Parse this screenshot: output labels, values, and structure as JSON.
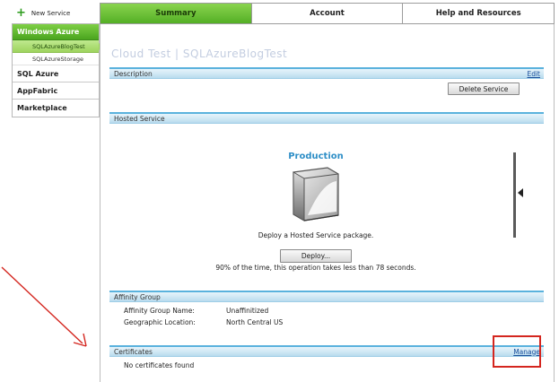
{
  "sidebar": {
    "new_service_label": "New Service",
    "groups": [
      {
        "label": "Windows Azure",
        "active": true
      },
      {
        "label": "SQL Azure",
        "active": false
      },
      {
        "label": "AppFabric",
        "active": false
      },
      {
        "label": "Marketplace",
        "active": false
      }
    ],
    "sub_items": [
      {
        "label": "SQLAzureBlogTest",
        "selected": true
      },
      {
        "label": "SQLAzureStorage",
        "selected": false
      }
    ]
  },
  "tabs": [
    {
      "label": "Summary",
      "active": true
    },
    {
      "label": "Account",
      "active": false
    },
    {
      "label": "Help and Resources",
      "active": false
    }
  ],
  "main": {
    "service_title": "Cloud Test | SQLAzureBlogTest",
    "description": {
      "label": "Description",
      "edit_label": "Edit",
      "delete_button": "Delete Service"
    },
    "hosted_service": {
      "label": "Hosted Service",
      "environment": "Production",
      "prompt": "Deploy a Hosted Service package.",
      "deploy_button": "Deploy...",
      "timing_note": "90% of the time, this operation takes less than 78 seconds."
    },
    "affinity_group": {
      "label": "Affinity Group",
      "name_label": "Affinity Group Name:",
      "name_value": "Unaffinitized",
      "location_label": "Geographic Location:",
      "location_value": "North Central US"
    },
    "certificates": {
      "label": "Certificates",
      "manage_label": "Manage",
      "empty_text": "No certificates found"
    }
  },
  "colors": {
    "accent_green": "#54af25",
    "section_blue": "#5ab2dd",
    "annotation_red": "#d4261f"
  }
}
